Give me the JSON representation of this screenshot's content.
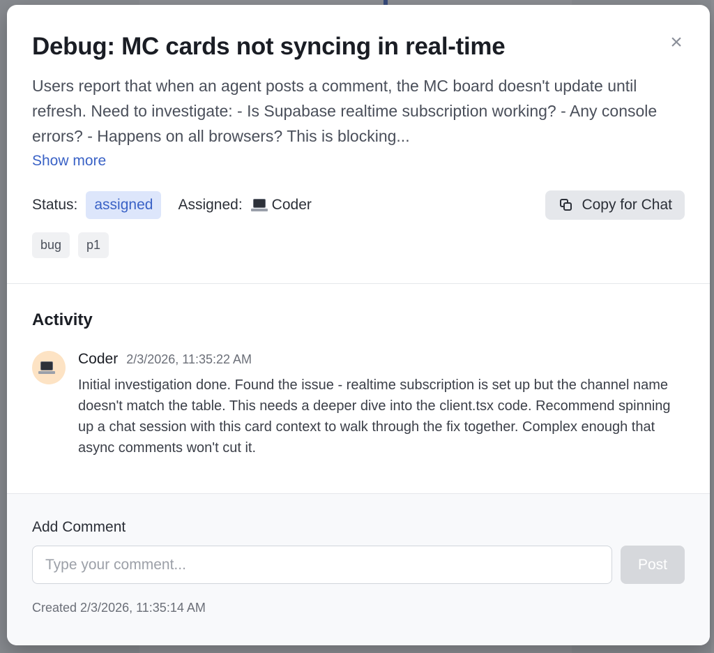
{
  "modal": {
    "title": "Debug: MC cards not syncing in real-time",
    "description": "Users report that when an agent posts a comment, the MC board doesn't update until refresh. Need to investigate: - Is Supabase realtime subscription working? - Any console errors? - Happens on all browsers? This is blocking...",
    "show_more": "Show more",
    "close_icon": "×",
    "status_label": "Status:",
    "status_value": "assigned",
    "assigned_label": "Assigned:",
    "assignee_name": "Coder",
    "assignee_icon": "laptop-icon",
    "copy_button": "Copy for Chat",
    "tags": [
      "bug",
      "p1"
    ]
  },
  "activity": {
    "title": "Activity",
    "comments": [
      {
        "author": "Coder",
        "timestamp": "2/3/2026, 11:35:22 AM",
        "avatar_icon": "laptop-icon",
        "text": "Initial investigation done. Found the issue - realtime subscription is set up but the channel name doesn't match the table. This needs a deeper dive into the client.tsx code. Recommend spinning up a chat session with this card context to walk through the fix together. Complex enough that async comments won't cut it."
      }
    ]
  },
  "add_comment": {
    "label": "Add Comment",
    "placeholder": "Type your comment...",
    "value": "",
    "post_button": "Post"
  },
  "footer": {
    "created": "Created 2/3/2026, 11:35:14 AM"
  },
  "colors": {
    "accent": "#3a62c6",
    "status_bg": "#dde6fb",
    "avatar_bg": "#fde3c4"
  }
}
